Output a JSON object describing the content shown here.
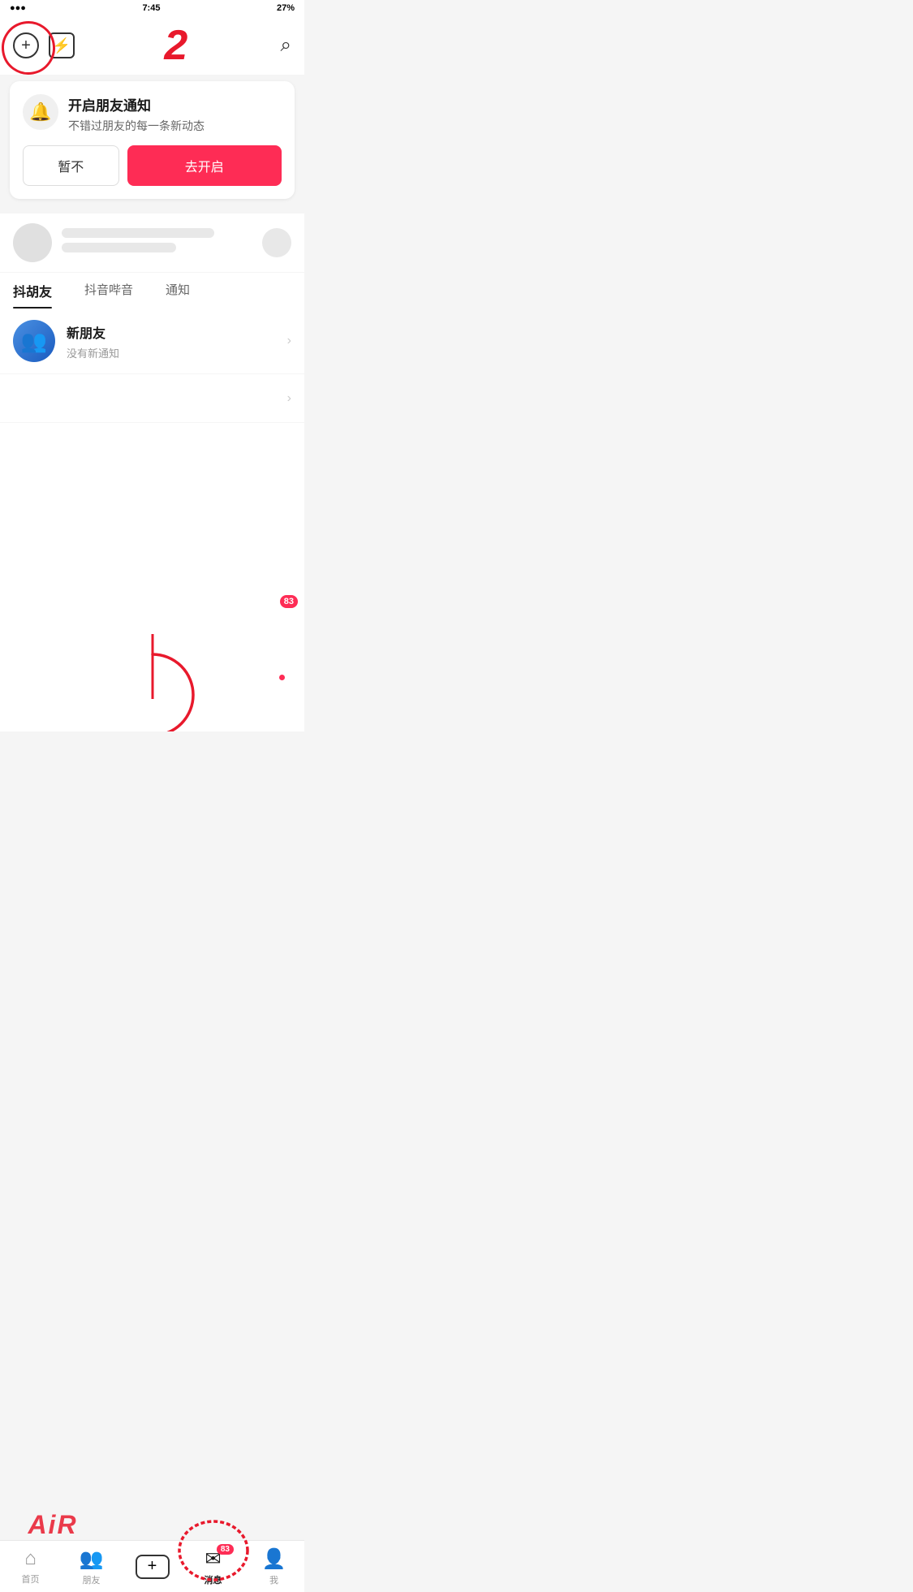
{
  "app": {
    "title": "消息"
  },
  "statusBar": {
    "time": "7:45",
    "battery": "27%"
  },
  "header": {
    "addButton": "+",
    "redNumber": "2",
    "lightningIcon": "⚡",
    "searchIcon": "🔍"
  },
  "notificationCard": {
    "bellIcon": "🔔",
    "title": "开启朋友通知",
    "subtitle": "不错过朋友的每一条新动态",
    "cancelLabel": "暂不",
    "confirmLabel": "去开启"
  },
  "tabs": [
    {
      "label": "抖胡友",
      "active": true
    },
    {
      "label": "抖音哔音",
      "active": false
    },
    {
      "label": "通知",
      "active": false
    }
  ],
  "friendRow": {
    "name": "新朋友",
    "status": "没有新通知"
  },
  "messageBadge": "83",
  "bottomNav": [
    {
      "label": "首页",
      "icon": "🏠",
      "active": false
    },
    {
      "label": "朋友",
      "icon": "👥",
      "active": false
    },
    {
      "label": "+",
      "icon": "+",
      "active": false,
      "isPlus": true
    },
    {
      "label": "消息",
      "icon": "💬",
      "active": true,
      "badge": "83"
    },
    {
      "label": "我",
      "icon": "👤",
      "active": false
    }
  ],
  "airWatermark": "AiR"
}
